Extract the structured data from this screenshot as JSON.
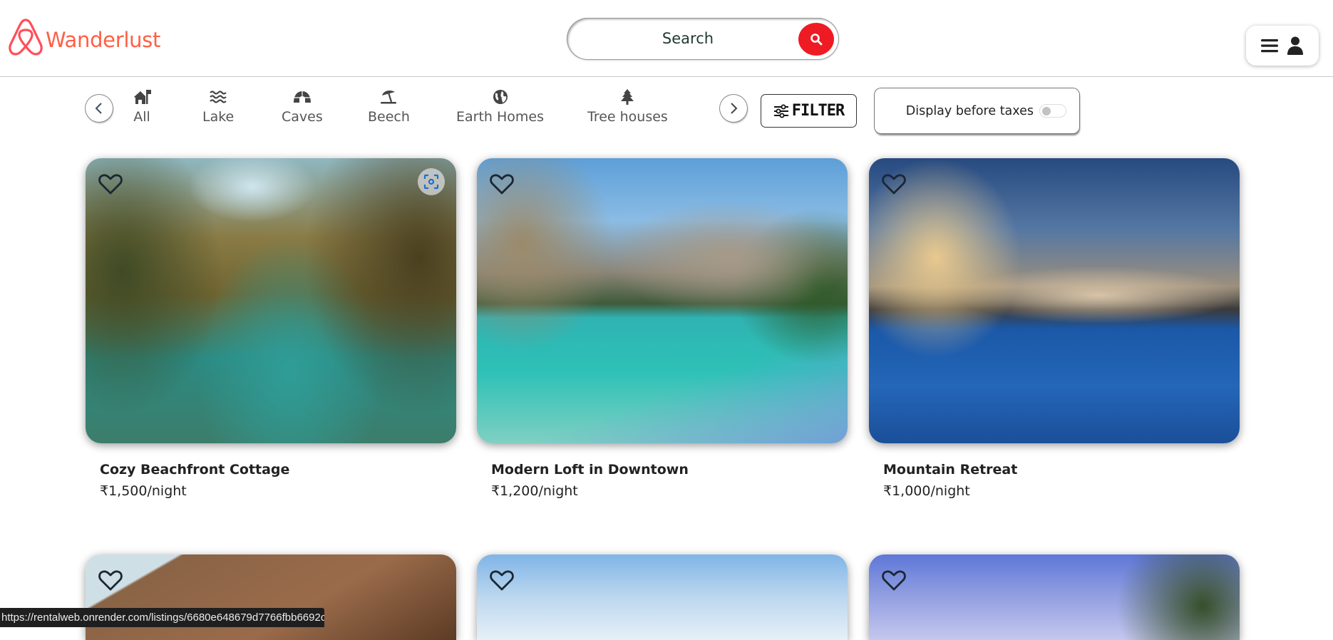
{
  "brand": {
    "name": "Wanderlust",
    "logo_icon": "airbnb-logo-icon",
    "color": "#fe5f45"
  },
  "search": {
    "placeholder": "Search",
    "value": "",
    "button_icon": "search-icon",
    "button_color": "#ee1b24"
  },
  "user_menu": {
    "icons": [
      "hamburger-menu-icon",
      "user-icon"
    ]
  },
  "categories": {
    "prev_icon": "chevron-left-icon",
    "next_icon": "chevron-right-icon",
    "items": [
      {
        "label": "All",
        "icon": "home-flag-icon"
      },
      {
        "label": "Lake",
        "icon": "water-waves-icon"
      },
      {
        "label": "Caves",
        "icon": "igloo-icon"
      },
      {
        "label": "Beech",
        "icon": "umbrella-beach-icon"
      },
      {
        "label": "Earth Homes",
        "icon": "globe-icon"
      },
      {
        "label": "Tree houses",
        "icon": "tree-icon"
      }
    ]
  },
  "filter": {
    "label": "FILTER",
    "icon": "sliders-icon"
  },
  "tax_toggle": {
    "label": "Display before taxes",
    "checked": false
  },
  "listings": [
    {
      "title": "Cozy Beachfront Cottage",
      "price": "₹1,500/night",
      "image": "tropical palm river with canoe"
    },
    {
      "title": "Modern Loft in Downtown",
      "price": "₹1,200/night",
      "image": "mountain lake with rowboat"
    },
    {
      "title": "Mountain Retreat",
      "price": "₹1,000/night",
      "image": "resort pool at dusk"
    },
    {
      "title": "",
      "price": "",
      "image": "wooden house roof with palm"
    },
    {
      "title": "",
      "price": "",
      "image": "tropical sea sky"
    },
    {
      "title": "",
      "price": "",
      "image": "sunset sky with palms"
    }
  ],
  "status_bar": {
    "url": "https://rentalweb.onrender.com/listings/6680e648679d7766fbb6692c"
  }
}
